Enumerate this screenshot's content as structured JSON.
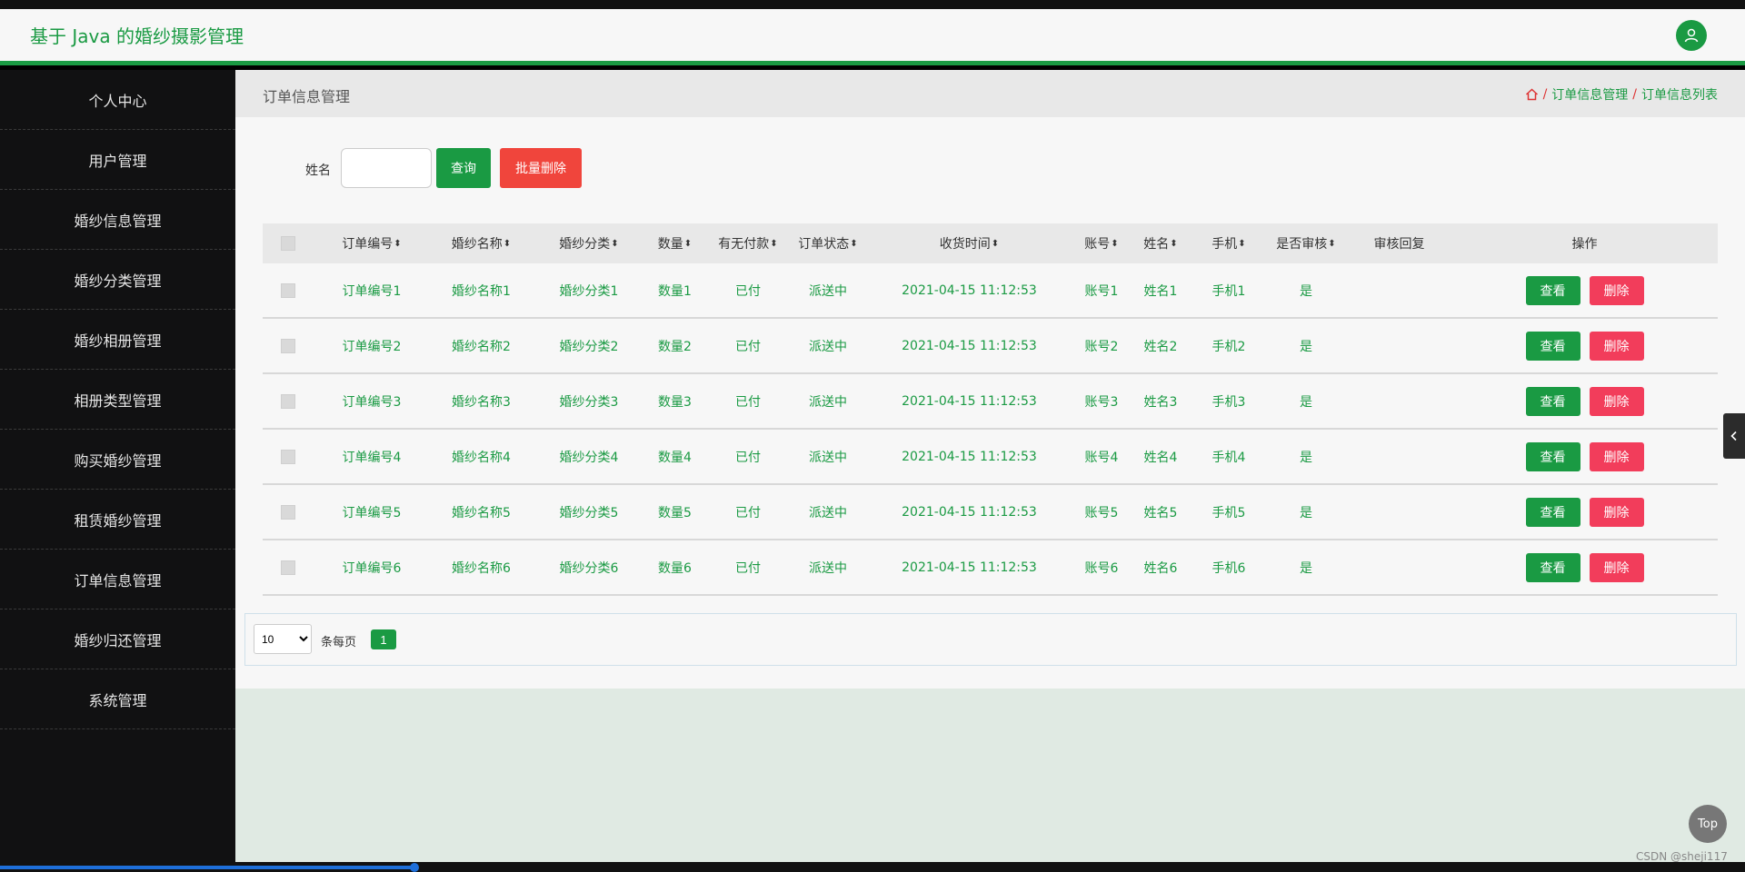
{
  "app": {
    "title": "基于 Java 的婚纱摄影管理"
  },
  "sidebar": {
    "items": [
      {
        "label": "个人中心"
      },
      {
        "label": "用户管理"
      },
      {
        "label": "婚纱信息管理"
      },
      {
        "label": "婚纱分类管理"
      },
      {
        "label": "婚纱相册管理"
      },
      {
        "label": "相册类型管理"
      },
      {
        "label": "购买婚纱管理"
      },
      {
        "label": "租赁婚纱管理"
      },
      {
        "label": "订单信息管理"
      },
      {
        "label": "婚纱归还管理"
      },
      {
        "label": "系统管理"
      }
    ]
  },
  "page": {
    "title": "订单信息管理",
    "breadcrumb": [
      "订单信息管理",
      "订单信息列表"
    ],
    "breadcrumb_sep": "/"
  },
  "search": {
    "label": "姓名",
    "value": "",
    "placeholder": "",
    "query_label": "查询",
    "batch_delete_label": "批量删除"
  },
  "table": {
    "sort_glyph": "⬍",
    "headers": {
      "order_no": "订单编号",
      "dress_name": "婚纱名称",
      "dress_category": "婚纱分类",
      "quantity": "数量",
      "paid": "有无付款",
      "status": "订单状态",
      "time": "收货时间",
      "account": "账号",
      "name": "姓名",
      "phone": "手机",
      "audited": "是否审核",
      "reply": "审核回复",
      "actions": "操作"
    },
    "view_label": "查看",
    "delete_label": "删除",
    "rows": [
      {
        "order_no": "订单编号1",
        "dress_name": "婚纱名称1",
        "dress_category": "婚纱分类1",
        "quantity": "数量1",
        "paid": "已付",
        "status": "派送中",
        "time": "2021-04-15 11:12:53",
        "account": "账号1",
        "name": "姓名1",
        "phone": "手机1",
        "audited": "是",
        "reply": ""
      },
      {
        "order_no": "订单编号2",
        "dress_name": "婚纱名称2",
        "dress_category": "婚纱分类2",
        "quantity": "数量2",
        "paid": "已付",
        "status": "派送中",
        "time": "2021-04-15 11:12:53",
        "account": "账号2",
        "name": "姓名2",
        "phone": "手机2",
        "audited": "是",
        "reply": ""
      },
      {
        "order_no": "订单编号3",
        "dress_name": "婚纱名称3",
        "dress_category": "婚纱分类3",
        "quantity": "数量3",
        "paid": "已付",
        "status": "派送中",
        "time": "2021-04-15 11:12:53",
        "account": "账号3",
        "name": "姓名3",
        "phone": "手机3",
        "audited": "是",
        "reply": ""
      },
      {
        "order_no": "订单编号4",
        "dress_name": "婚纱名称4",
        "dress_category": "婚纱分类4",
        "quantity": "数量4",
        "paid": "已付",
        "status": "派送中",
        "time": "2021-04-15 11:12:53",
        "account": "账号4",
        "name": "姓名4",
        "phone": "手机4",
        "audited": "是",
        "reply": ""
      },
      {
        "order_no": "订单编号5",
        "dress_name": "婚纱名称5",
        "dress_category": "婚纱分类5",
        "quantity": "数量5",
        "paid": "已付",
        "status": "派送中",
        "time": "2021-04-15 11:12:53",
        "account": "账号5",
        "name": "姓名5",
        "phone": "手机5",
        "audited": "是",
        "reply": ""
      },
      {
        "order_no": "订单编号6",
        "dress_name": "婚纱名称6",
        "dress_category": "婚纱分类6",
        "quantity": "数量6",
        "paid": "已付",
        "status": "派送中",
        "time": "2021-04-15 11:12:53",
        "account": "账号6",
        "name": "姓名6",
        "phone": "手机6",
        "audited": "是",
        "reply": ""
      }
    ]
  },
  "pagination": {
    "page_size": "10",
    "per_page_label": "条每页",
    "current_page": "1"
  },
  "misc": {
    "top_label": "Top",
    "watermark": "CSDN @sheji117"
  },
  "icons": {
    "user": "user-icon",
    "home": "home-icon",
    "collapse": "chevron-left-icon",
    "dropdown": "caret-down-icon"
  },
  "colors": {
    "accent": "#1a9a43",
    "danger": "#f0453c",
    "delete": "#f23d5b",
    "sidebar_bg": "#111112"
  }
}
